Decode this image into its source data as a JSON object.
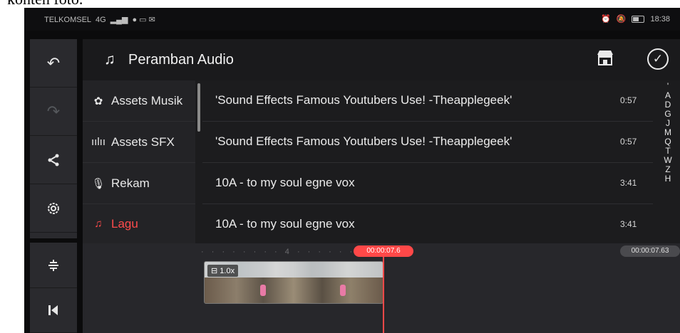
{
  "caption": "konten foto.",
  "statusbar": {
    "carrier": "TELKOMSEL",
    "network": "4G",
    "time": "18:38"
  },
  "toolbar": {
    "undo_icon": "undo-icon",
    "redo_icon": "redo-icon",
    "share_icon": "share-icon",
    "settings_icon": "settings-icon",
    "split_icon": "split-icon",
    "skip_start_icon": "skip-to-start-icon"
  },
  "panel": {
    "title": "Peramban Audio"
  },
  "categories": [
    {
      "label": "Assets Musik"
    },
    {
      "label": "Assets SFX"
    },
    {
      "label": "Rekam"
    },
    {
      "label": "Lagu"
    }
  ],
  "tracks": [
    {
      "name": "'Sound Effects Famous Youtubers Use! -Theapplegeek'",
      "duration": "0:57"
    },
    {
      "name": "'Sound Effects Famous Youtubers Use! -Theapplegeek'",
      "duration": "0:57"
    },
    {
      "name": "10A - to my soul egne vox",
      "duration": "3:41"
    },
    {
      "name": "10A - to my soul egne vox",
      "duration": "3:41"
    }
  ],
  "alphabet": [
    "'",
    "A",
    "D",
    "G",
    "J",
    "M",
    "Q",
    "T",
    "W",
    "Z",
    "H"
  ],
  "timeline": {
    "ruler_mark": "4",
    "playhead_time": "00:00:07.6",
    "total_time": "00:00:07.63",
    "clip_speed": "1.0x"
  },
  "colors": {
    "accent": "#ff4848",
    "background": "#0b0b0c"
  }
}
